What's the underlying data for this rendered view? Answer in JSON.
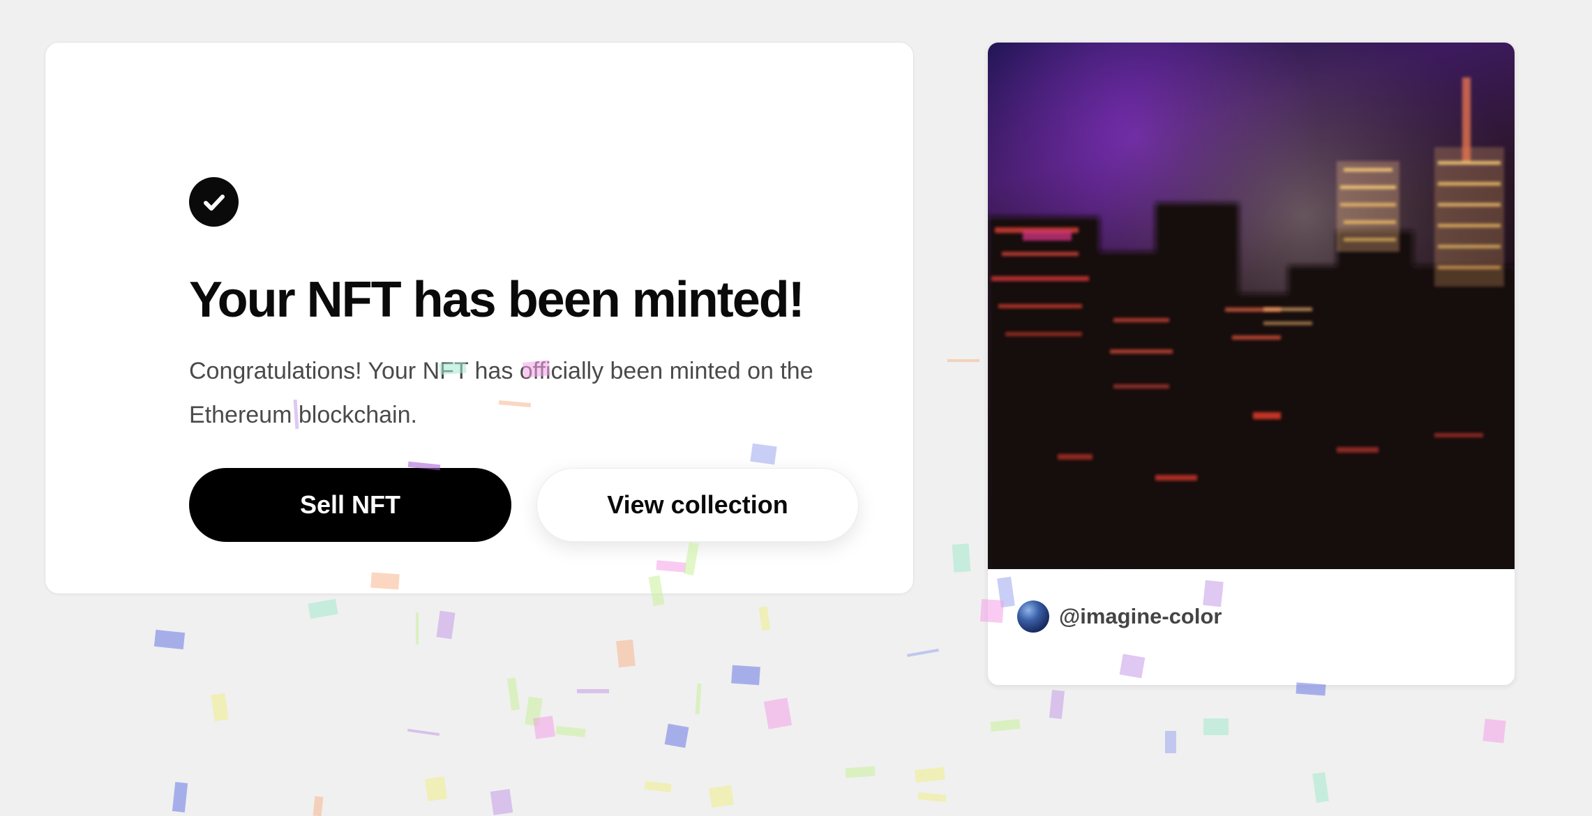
{
  "mint_card": {
    "icon": "check-circle-icon",
    "title": "Your NFT has been minted!",
    "message": "Congratulations! Your NFT has officially been minted on the Ethereum blockchain.",
    "sell_label": "Sell NFT",
    "view_label": "View collection"
  },
  "nft_card": {
    "image": "nft-cityscape-image",
    "creator": "@imagine-color"
  },
  "colors": {
    "background": "#f0f0f0",
    "primary_button": "#000000",
    "text": "#0a0a0a",
    "muted_text": "#4a4a4a",
    "confetti": [
      "#f4a0e8",
      "#9aa5ee",
      "#a4e9cf",
      "#f7b690",
      "#c8f09a",
      "#eeee88",
      "#c49ae6"
    ]
  }
}
